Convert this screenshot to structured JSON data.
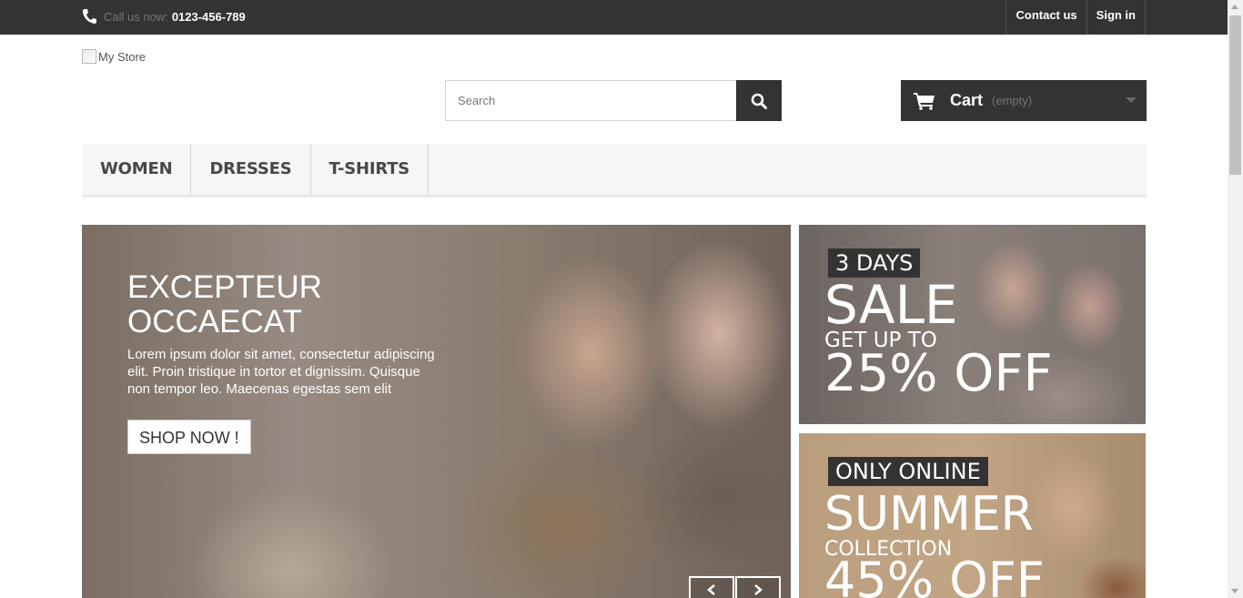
{
  "topbar": {
    "call_label": "Call us now:",
    "phone": "0123-456-789",
    "links": [
      "Contact us",
      "Sign in"
    ]
  },
  "logo": {
    "alt": "My Store"
  },
  "search": {
    "placeholder": "Search"
  },
  "cart": {
    "label": "Cart",
    "status": "(empty)"
  },
  "menu": [
    "WOMEN",
    "DRESSES",
    "T-SHIRTS"
  ],
  "slider": {
    "title_line1": "EXCEPTEUR",
    "title_line2": "OCCAECAT",
    "description": "Lorem ipsum dolor sit amet, consectetur adipiscing elit. Proin tristique in tortor et dignissim. Quisque non tempor leo. Maecenas egestas sem elit",
    "button": "SHOP NOW !"
  },
  "banners": [
    {
      "tag": "3 DAYS",
      "line1": "SALE",
      "line2": "GET UP TO",
      "line3": "25% OFF"
    },
    {
      "tag": "ONLY ONLINE",
      "line1": "SUMMER",
      "line2": "COLLECTION",
      "line3": "45% OFF"
    }
  ],
  "colors": {
    "dark": "#333333",
    "menu_bg": "#f6f6f6",
    "muted": "#777777"
  },
  "icons": [
    "phone-icon",
    "search-icon",
    "cart-icon",
    "chevron-left-icon",
    "chevron-right-icon"
  ]
}
